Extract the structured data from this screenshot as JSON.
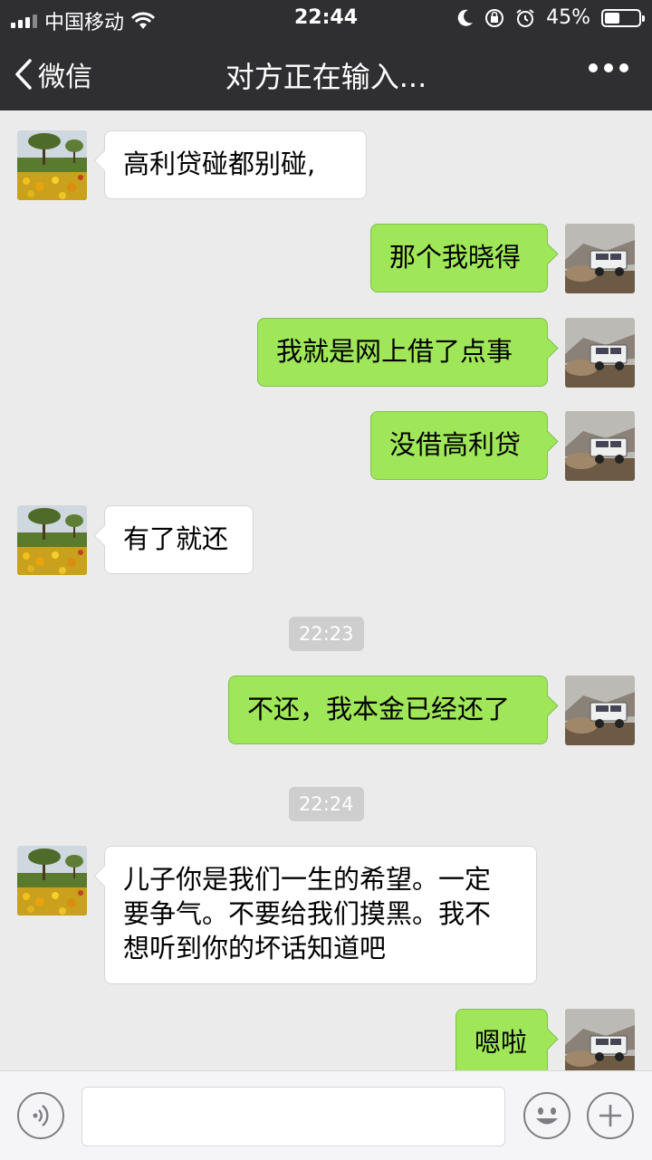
{
  "status_bar": {
    "carrier": "中国移动",
    "time": "22:44",
    "battery": "45%",
    "battery_level": 0.45,
    "icons": [
      "signal-icon",
      "wifi-icon",
      "moon-icon",
      "rotation-lock-icon",
      "alarm-icon",
      "battery-icon"
    ]
  },
  "nav": {
    "back_label": "微信",
    "title": "对方正在输入...",
    "more_icon": "more-dots-icon"
  },
  "messages": [
    {
      "side": "in",
      "text": "高利贷碰都别碰,"
    },
    {
      "side": "out",
      "text": "那个我晓得"
    },
    {
      "side": "out",
      "text": "我就是网上借了点事"
    },
    {
      "side": "out",
      "text": "没借高利贷"
    },
    {
      "side": "in",
      "text": "有了就还"
    },
    {
      "timestamp": "22:23"
    },
    {
      "side": "out",
      "text": "不还，我本金已经还了"
    },
    {
      "timestamp": "22:24"
    },
    {
      "side": "in",
      "lines": [
        "儿子你是我们一生的希望。一定",
        "要争气。不要给我们摸黑。我不",
        "想听到你的坏话知道吧"
      ]
    },
    {
      "side": "out",
      "text": "嗯啦"
    }
  ],
  "input_bar": {
    "voice_icon": "voice-icon",
    "text_value": "",
    "emoji_icon": "emoji-icon",
    "plus_icon": "plus-icon"
  },
  "colors": {
    "header_bg": "#2f2f32",
    "chat_bg": "#ebebeb",
    "outgoing_bubble": "#9fe658",
    "incoming_bubble": "#ffffff"
  }
}
